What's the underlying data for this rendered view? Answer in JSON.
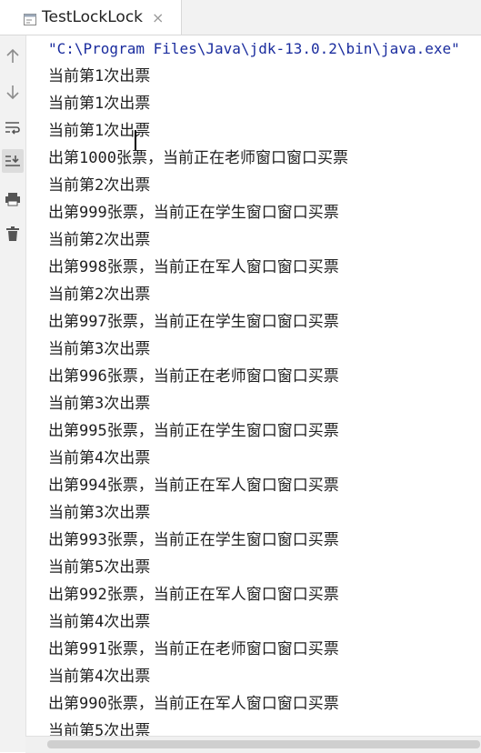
{
  "tab": {
    "label": "TestLockLock",
    "close": "×"
  },
  "toolbar": {
    "icons": [
      "up-arrow-icon",
      "down-arrow-icon",
      "soft-wrap-icon",
      "scroll-to-end-icon",
      "print-icon",
      "trash-icon"
    ]
  },
  "console": {
    "lines": [
      "\"C:\\Program Files\\Java\\jdk-13.0.2\\bin\\java.exe\"",
      "当前第1次出票",
      "当前第1次出票",
      "当前第1次出票",
      "出第1000张票，当前正在老师窗口窗口买票",
      "当前第2次出票",
      "出第999张票，当前正在学生窗口窗口买票",
      "当前第2次出票",
      "出第998张票，当前正在军人窗口窗口买票",
      "当前第2次出票",
      "出第997张票，当前正在学生窗口窗口买票",
      "当前第3次出票",
      "出第996张票，当前正在老师窗口窗口买票",
      "当前第3次出票",
      "出第995张票，当前正在学生窗口窗口买票",
      "当前第4次出票",
      "出第994张票，当前正在军人窗口窗口买票",
      "当前第3次出票",
      "出第993张票，当前正在学生窗口窗口买票",
      "当前第5次出票",
      "出第992张票，当前正在军人窗口窗口买票",
      "当前第4次出票",
      "出第991张票，当前正在老师窗口窗口买票",
      "当前第4次出票",
      "出第990张票，当前正在军人窗口窗口买票",
      "当前第5次出票"
    ]
  },
  "colors": {
    "command": "#1a2c9e",
    "text": "#1f1f1f",
    "panel": "#f2f2f2"
  }
}
